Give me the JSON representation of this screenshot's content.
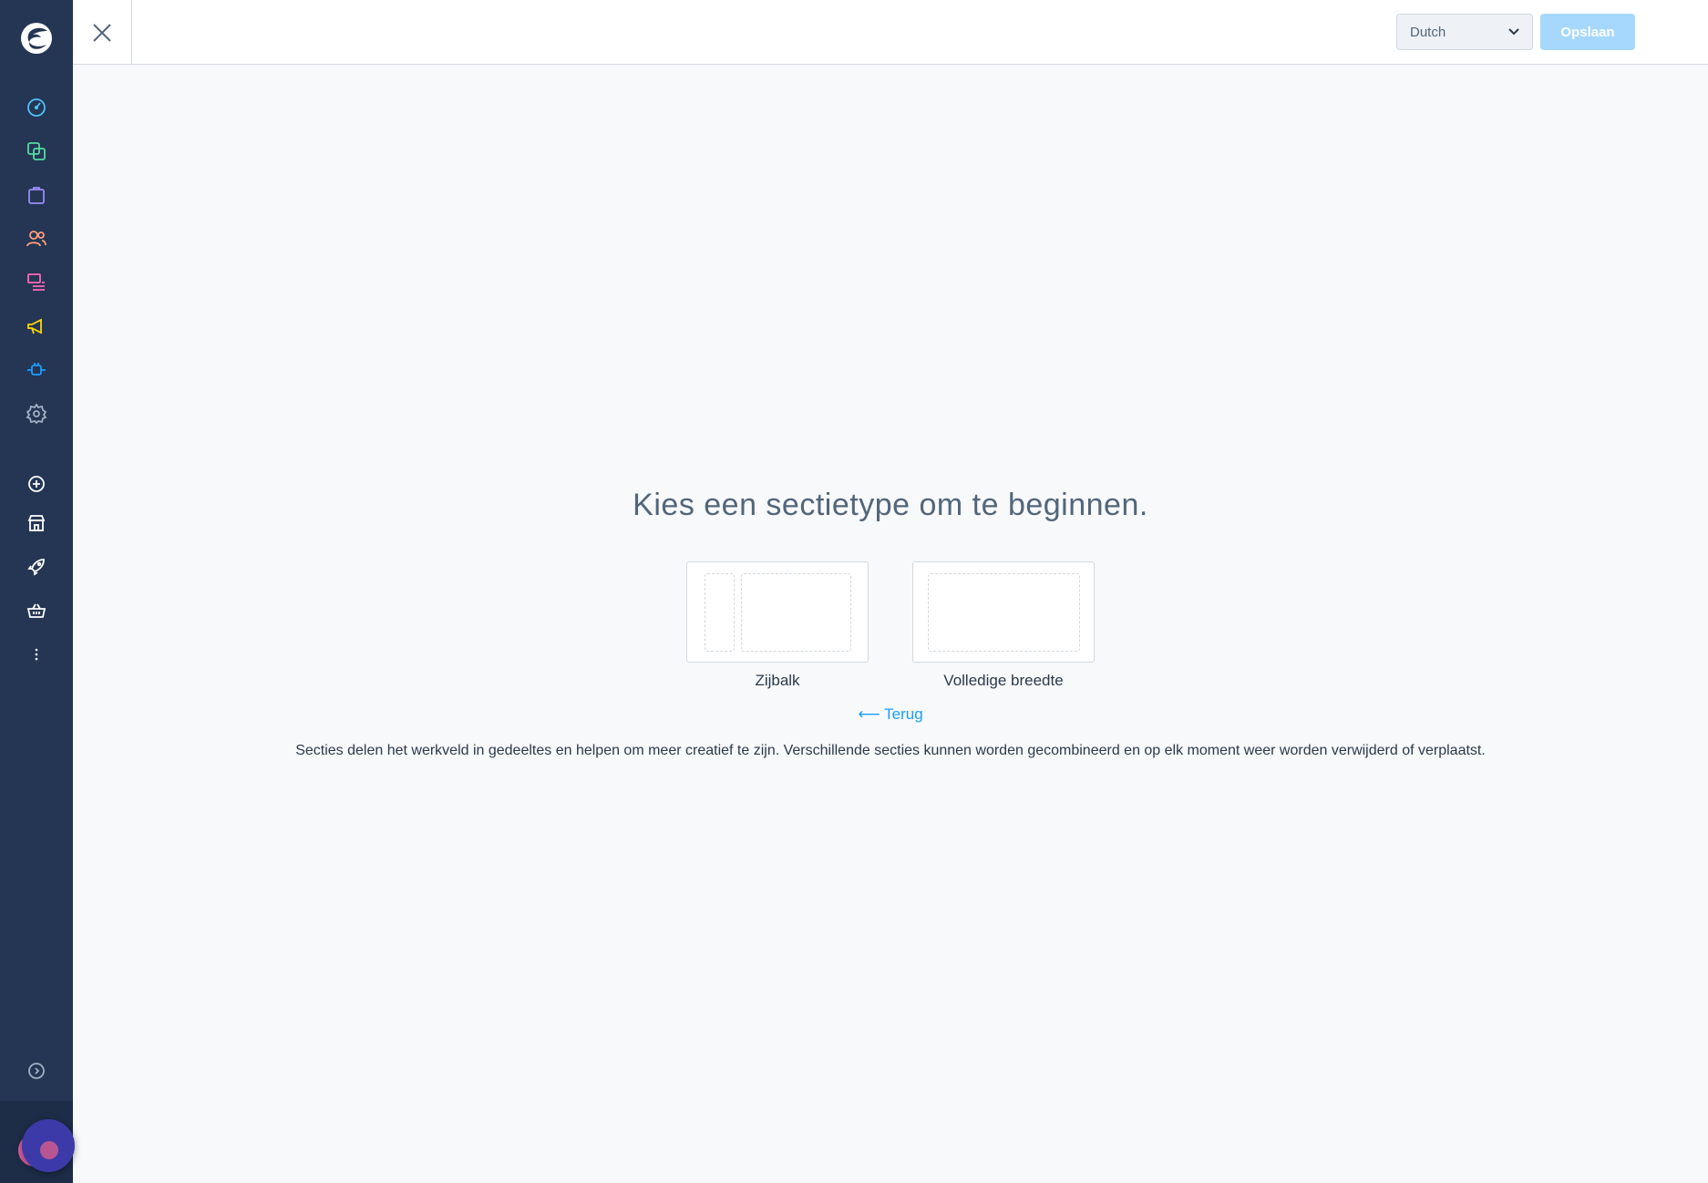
{
  "topbar": {
    "language": "Dutch",
    "save_label": "Opslaan"
  },
  "main": {
    "heading": "Kies een sectietype om te beginnen.",
    "options": [
      {
        "label": "Zijbalk"
      },
      {
        "label": "Volledige breedte"
      }
    ],
    "back_label": "Terug",
    "description": "Secties delen het werkveld in gedeeltes en helpen om meer creatief te zijn. Verschillende secties kunnen worden gecombineerd en op elk moment weer worden verwijderd of verplaatst."
  },
  "sidebar": {
    "icons": [
      {
        "name": "dashboard-icon",
        "color": "#4fc3f7"
      },
      {
        "name": "catalogue-icon",
        "color": "#57d9a3"
      },
      {
        "name": "orders-icon",
        "color": "#9c8cf7"
      },
      {
        "name": "customers-icon",
        "color": "#ff9f7a"
      },
      {
        "name": "content-icon",
        "color": "#ff68b4"
      },
      {
        "name": "marketing-icon",
        "color": "#ffd700"
      },
      {
        "name": "extensions-icon",
        "color": "#189eff"
      },
      {
        "name": "settings-icon",
        "color": "#a0b1c2"
      },
      {
        "name": "add-sales-channel-icon",
        "color": "#ffffff"
      },
      {
        "name": "storefront-icon",
        "color": "#ffffff"
      },
      {
        "name": "headless-icon",
        "color": "#ffffff"
      },
      {
        "name": "basket-icon",
        "color": "#ffffff"
      },
      {
        "name": "more-icon",
        "color": "#ffffff"
      },
      {
        "name": "collapse-sidebar-icon",
        "color": "#a0b1c2"
      }
    ]
  }
}
